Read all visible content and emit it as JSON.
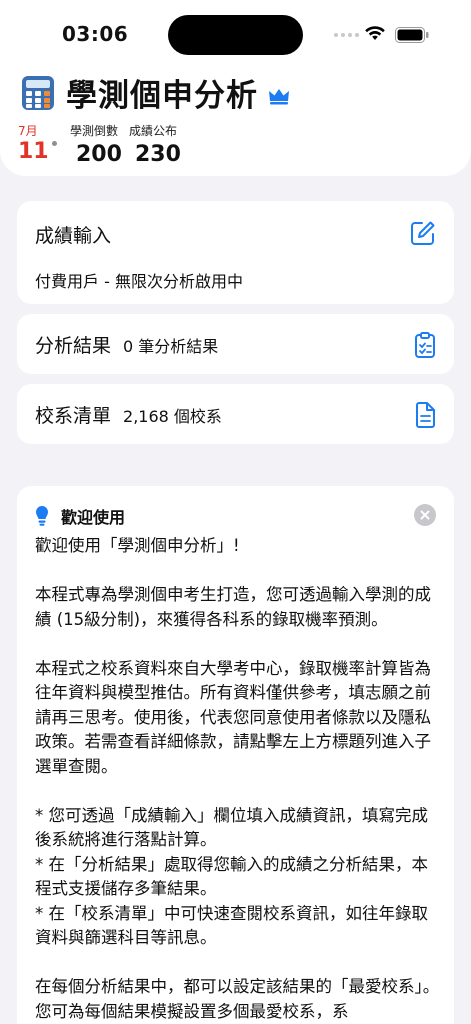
{
  "status": {
    "time": "03:06"
  },
  "header": {
    "app_icon": "calculator-icon",
    "title": "學測個申分析",
    "premium_icon": "crown-icon",
    "date": {
      "month": "7月",
      "day": "11"
    },
    "countdown": {
      "label": "學測倒數",
      "value": "200"
    },
    "announce": {
      "label": "成績公布",
      "value": "230"
    }
  },
  "cards": {
    "score": {
      "title": "成績輸入",
      "subtitle": "付費用戶 - 無限次分析啟用中",
      "icon": "edit-icon"
    },
    "results": {
      "title": "分析結果",
      "meta": "0 筆分析結果",
      "icon": "clipboard-check-icon"
    },
    "list": {
      "title": "校系清單",
      "meta": "2,168 個校系",
      "icon": "document-icon"
    }
  },
  "welcome": {
    "icon": "lightbulb-icon",
    "title": "歡迎使用",
    "p1": "歡迎使用「學測個申分析」!",
    "p2": "本程式專為學測個申考生打造，您可透過輸入學測的成績 (15級分制)，來獲得各科系的錄取機率預測。",
    "p3": "本程式之校系資料來自大學考中心，錄取機率計算皆為往年資料與模型推估。所有資料僅供參考，填志願之前請再三思考。使用後，代表您同意使用者條款以及隱私政策。若需查看詳細條款，請點擊左上方標題列進入子選單查閱。",
    "b1": "* 您可透過「成績輸入」欄位填入成績資訊，填寫完成後系統將進行落點計算。",
    "b2": "* 在「分析結果」處取得您輸入的成績之分析結果，本程式支援儲存多筆結果。",
    "b3": "* 在「校系清單」中可快速查閱校系資訊，如往年錄取資料與篩選科目等訊息。",
    "p4": "在每個分析結果中，都可以設定該結果的「最愛校系」。您可為每個結果模擬設置多個最愛校系，系"
  },
  "colors": {
    "accent": "#1e7cf2",
    "date_red": "#e0332b",
    "background": "#f2f2f7"
  }
}
